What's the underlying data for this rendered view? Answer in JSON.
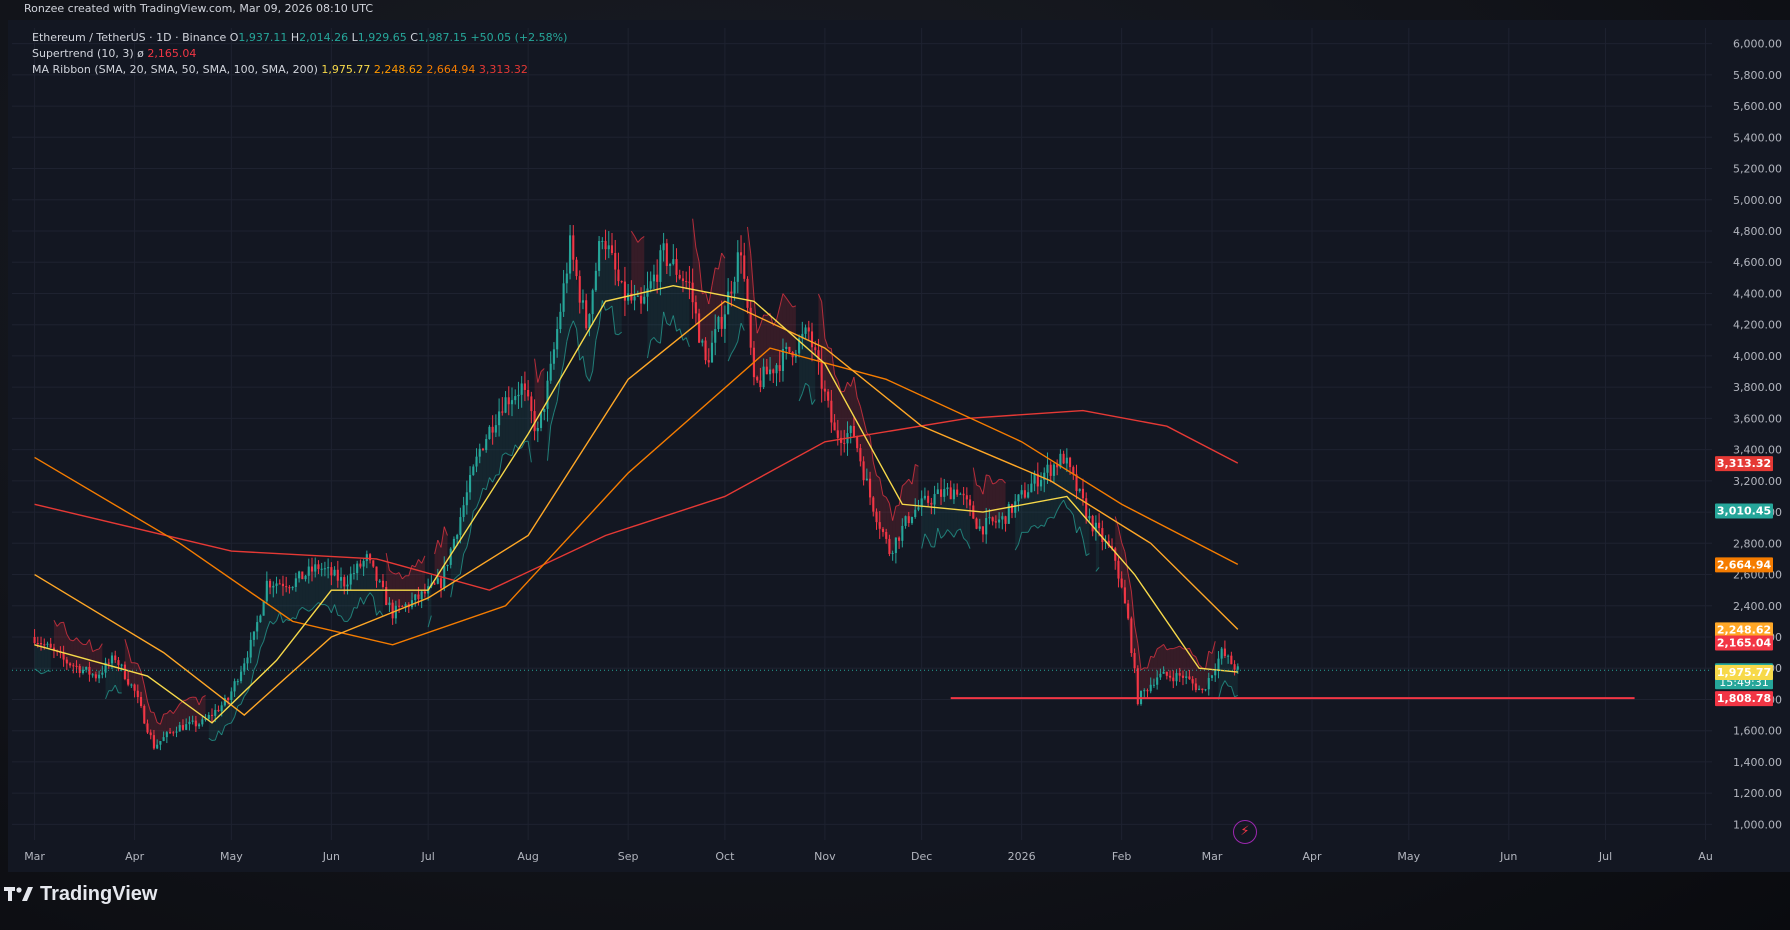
{
  "caption": "Ronzee created with TradingView.com, Mar 09, 2026 08:10 UTC",
  "brand": "TradingView",
  "legend": {
    "symbol": "Ethereum / TetherUS · 1D · Binance",
    "o_label": "O",
    "o_value": "1,937.11",
    "h_label": "H",
    "h_value": "2,014.26",
    "l_label": "L",
    "l_value": "1,929.65",
    "c_label": "C",
    "c_value": "1,987.15",
    "change": "+50.05 (+2.58%)",
    "supertrend_label": "Supertrend (10, 3)",
    "supertrend_symbol": "ø",
    "supertrend_value": "2,165.04",
    "ma_label": "MA Ribbon (SMA, 20, SMA, 50, SMA, 100, SMA, 200)",
    "ma20": "1,975.77",
    "ma50": "2,248.62",
    "ma100": "2,664.94",
    "ma200": "3,313.32"
  },
  "colors": {
    "up": "#26a69a",
    "down": "#f23645",
    "ma20": "#f7d94a",
    "ma50": "#ffa726",
    "ma100": "#f57c00",
    "ma200": "#e53935",
    "support_line": "#f23645",
    "grid": "#1e2230",
    "axis_text": "#b2b5be"
  },
  "chart_data": {
    "type": "line",
    "title": "Ethereum / TetherUS · 1D · Binance",
    "ylim": [
      900,
      6100
    ],
    "y_ticks": [
      "1,000.00",
      "1,200.00",
      "1,400.00",
      "1,600.00",
      "1,800.00",
      "2,000.00",
      "2,200.00",
      "2,400.00",
      "2,600.00",
      "2,800.00",
      "3,000.00",
      "3,200.00",
      "3,400.00",
      "3,600.00",
      "3,800.00",
      "4,000.00",
      "4,200.00",
      "4,400.00",
      "4,600.00",
      "4,800.00",
      "5,000.00",
      "5,200.00",
      "5,400.00",
      "5,600.00",
      "5,800.00",
      "6,000.00"
    ],
    "x_ticks": [
      "Mar",
      "Apr",
      "May",
      "Jun",
      "Jul",
      "Aug",
      "Sep",
      "Oct",
      "Nov",
      "Dec",
      "2026",
      "Feb",
      "Mar",
      "Apr",
      "May",
      "Jun",
      "Jul",
      "Au"
    ],
    "grid": true,
    "price_path": [
      {
        "d": "2025-03-01",
        "p": 2200
      },
      {
        "d": "2025-03-10",
        "p": 2050
      },
      {
        "d": "2025-03-20",
        "p": 1950
      },
      {
        "d": "2025-03-26",
        "p": 2070
      },
      {
        "d": "2025-04-01",
        "p": 1850
      },
      {
        "d": "2025-04-07",
        "p": 1500
      },
      {
        "d": "2025-04-14",
        "p": 1620
      },
      {
        "d": "2025-04-22",
        "p": 1650
      },
      {
        "d": "2025-04-30",
        "p": 1800
      },
      {
        "d": "2025-05-08",
        "p": 2200
      },
      {
        "d": "2025-05-12",
        "p": 2550
      },
      {
        "d": "2025-05-20",
        "p": 2550
      },
      {
        "d": "2025-05-28",
        "p": 2650
      },
      {
        "d": "2025-06-05",
        "p": 2550
      },
      {
        "d": "2025-06-12",
        "p": 2700
      },
      {
        "d": "2025-06-20",
        "p": 2350
      },
      {
        "d": "2025-06-28",
        "p": 2450
      },
      {
        "d": "2025-07-05",
        "p": 2550
      },
      {
        "d": "2025-07-10",
        "p": 2900
      },
      {
        "d": "2025-07-17",
        "p": 3400
      },
      {
        "d": "2025-07-24",
        "p": 3700
      },
      {
        "d": "2025-07-30",
        "p": 3800
      },
      {
        "d": "2025-08-04",
        "p": 3500
      },
      {
        "d": "2025-08-08",
        "p": 3900
      },
      {
        "d": "2025-08-14",
        "p": 4700
      },
      {
        "d": "2025-08-19",
        "p": 4200
      },
      {
        "d": "2025-08-24",
        "p": 4800
      },
      {
        "d": "2025-08-30",
        "p": 4400
      },
      {
        "d": "2025-09-05",
        "p": 4300
      },
      {
        "d": "2025-09-12",
        "p": 4650
      },
      {
        "d": "2025-09-20",
        "p": 4450
      },
      {
        "d": "2025-09-25",
        "p": 3950
      },
      {
        "d": "2025-10-01",
        "p": 4300
      },
      {
        "d": "2025-10-06",
        "p": 4700
      },
      {
        "d": "2025-10-10",
        "p": 3800
      },
      {
        "d": "2025-10-17",
        "p": 3950
      },
      {
        "d": "2025-10-27",
        "p": 4150
      },
      {
        "d": "2025-11-04",
        "p": 3500
      },
      {
        "d": "2025-11-10",
        "p": 3500
      },
      {
        "d": "2025-11-15",
        "p": 3100
      },
      {
        "d": "2025-11-21",
        "p": 2750
      },
      {
        "d": "2025-11-28",
        "p": 3000
      },
      {
        "d": "2025-12-05",
        "p": 3100
      },
      {
        "d": "2025-12-12",
        "p": 3150
      },
      {
        "d": "2025-12-19",
        "p": 2900
      },
      {
        "d": "2025-12-26",
        "p": 2950
      },
      {
        "d": "2026-01-05",
        "p": 3200
      },
      {
        "d": "2026-01-14",
        "p": 3350
      },
      {
        "d": "2026-01-22",
        "p": 2950
      },
      {
        "d": "2026-01-30",
        "p": 2700
      },
      {
        "d": "2026-02-03",
        "p": 2300
      },
      {
        "d": "2026-02-06",
        "p": 1800
      },
      {
        "d": "2026-02-12",
        "p": 1950
      },
      {
        "d": "2026-02-20",
        "p": 1950
      },
      {
        "d": "2026-02-26",
        "p": 1850
      },
      {
        "d": "2026-03-04",
        "p": 2100
      },
      {
        "d": "2026-03-09",
        "p": 1987
      }
    ],
    "ma20": [
      {
        "d": "2025-03-01",
        "p": 2150
      },
      {
        "d": "2025-04-05",
        "p": 1950
      },
      {
        "d": "2025-04-25",
        "p": 1650
      },
      {
        "d": "2025-05-15",
        "p": 2050
      },
      {
        "d": "2025-06-01",
        "p": 2500
      },
      {
        "d": "2025-07-01",
        "p": 2500
      },
      {
        "d": "2025-08-01",
        "p": 3500
      },
      {
        "d": "2025-08-25",
        "p": 4350
      },
      {
        "d": "2025-09-15",
        "p": 4450
      },
      {
        "d": "2025-10-10",
        "p": 4350
      },
      {
        "d": "2025-11-01",
        "p": 3950
      },
      {
        "d": "2025-11-25",
        "p": 3050
      },
      {
        "d": "2025-12-20",
        "p": 3000
      },
      {
        "d": "2026-01-15",
        "p": 3100
      },
      {
        "d": "2026-02-05",
        "p": 2600
      },
      {
        "d": "2026-02-25",
        "p": 2000
      },
      {
        "d": "2026-03-09",
        "p": 1975.77
      }
    ],
    "ma50": [
      {
        "d": "2025-03-01",
        "p": 2600
      },
      {
        "d": "2025-04-10",
        "p": 2100
      },
      {
        "d": "2025-05-05",
        "p": 1700
      },
      {
        "d": "2025-06-01",
        "p": 2200
      },
      {
        "d": "2025-07-01",
        "p": 2450
      },
      {
        "d": "2025-08-01",
        "p": 2850
      },
      {
        "d": "2025-09-01",
        "p": 3850
      },
      {
        "d": "2025-10-01",
        "p": 4350
      },
      {
        "d": "2025-11-01",
        "p": 4050
      },
      {
        "d": "2025-12-01",
        "p": 3550
      },
      {
        "d": "2026-01-10",
        "p": 3200
      },
      {
        "d": "2026-02-10",
        "p": 2800
      },
      {
        "d": "2026-03-09",
        "p": 2248.62
      }
    ],
    "ma100": [
      {
        "d": "2025-03-01",
        "p": 3350
      },
      {
        "d": "2025-04-15",
        "p": 2800
      },
      {
        "d": "2025-05-20",
        "p": 2300
      },
      {
        "d": "2025-06-20",
        "p": 2150
      },
      {
        "d": "2025-07-25",
        "p": 2400
      },
      {
        "d": "2025-09-01",
        "p": 3250
      },
      {
        "d": "2025-10-15",
        "p": 4050
      },
      {
        "d": "2025-11-20",
        "p": 3850
      },
      {
        "d": "2026-01-01",
        "p": 3450
      },
      {
        "d": "2026-02-01",
        "p": 3050
      },
      {
        "d": "2026-03-09",
        "p": 2664.94
      }
    ],
    "ma200": [
      {
        "d": "2025-03-01",
        "p": 3050
      },
      {
        "d": "2025-05-01",
        "p": 2750
      },
      {
        "d": "2025-06-15",
        "p": 2700
      },
      {
        "d": "2025-07-20",
        "p": 2500
      },
      {
        "d": "2025-08-25",
        "p": 2850
      },
      {
        "d": "2025-10-01",
        "p": 3100
      },
      {
        "d": "2025-11-01",
        "p": 3450
      },
      {
        "d": "2025-12-15",
        "p": 3600
      },
      {
        "d": "2026-01-20",
        "p": 3650
      },
      {
        "d": "2026-02-15",
        "p": 3550
      },
      {
        "d": "2026-03-09",
        "p": 3313.32
      }
    ],
    "support": {
      "from": "2025-12-10",
      "to": "2026-07-10",
      "p": 1808.78
    },
    "last_price_line": 1987.15,
    "price_labels": [
      {
        "value": 3313.32,
        "text": "3,313.32",
        "color": "#e53935"
      },
      {
        "value": 3010.45,
        "text": "3,010.45",
        "color": "#26a69a"
      },
      {
        "value": 2664.94,
        "text": "2,664.94",
        "color": "#f57c00"
      },
      {
        "value": 2248.62,
        "text": "2,248.62",
        "color": "#ffa726"
      },
      {
        "value": 2165.04,
        "text": "2,165.04",
        "color": "#f23645"
      },
      {
        "value": 1987.15,
        "text": "1,987.15",
        "sub": "15:49:31",
        "color": "#26a69a"
      },
      {
        "value": 1975.77,
        "text": "1,975.77",
        "color": "#f7d94a"
      },
      {
        "value": 1808.78,
        "text": "1,808.78",
        "color": "#f23645"
      }
    ]
  }
}
